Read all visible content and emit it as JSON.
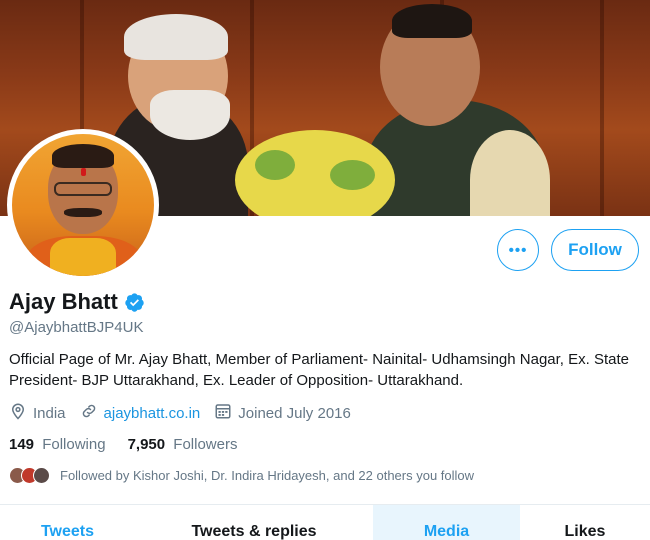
{
  "profile": {
    "name": "Ajay Bhatt",
    "handle": "@AjaybhattBJP4UK",
    "bio": "Official Page of Mr. Ajay Bhatt, Member of Parliament- Nainital- Udhamsingh Nagar, Ex. State President- BJP Uttarakhand, Ex.  Leader of Opposition- Uttarakhand.",
    "location": "India",
    "website": "ajaybhatt.co.in",
    "joined": "Joined July 2016",
    "verified": true
  },
  "actions": {
    "more_label": "•••",
    "follow_label": "Follow"
  },
  "stats": {
    "following_count": "149",
    "following_label": "Following",
    "followers_count": "7,950",
    "followers_label": "Followers"
  },
  "followed_by": {
    "text": "Followed by Kishor Joshi, Dr. Indira Hridayesh, and 22 others you follow"
  },
  "tabs": [
    {
      "label": "Tweets"
    },
    {
      "label": "Tweets & replies"
    },
    {
      "label": "Media"
    },
    {
      "label": "Likes"
    }
  ],
  "icons": {
    "location": "location-pin-icon",
    "link": "link-icon",
    "calendar": "calendar-icon",
    "verified": "verified-badge-icon"
  },
  "colors": {
    "accent": "#1da1f2",
    "link": "#1b95e0",
    "muted": "#657786",
    "text": "#14171a",
    "active_tab_bg": "#e8f5fd"
  }
}
